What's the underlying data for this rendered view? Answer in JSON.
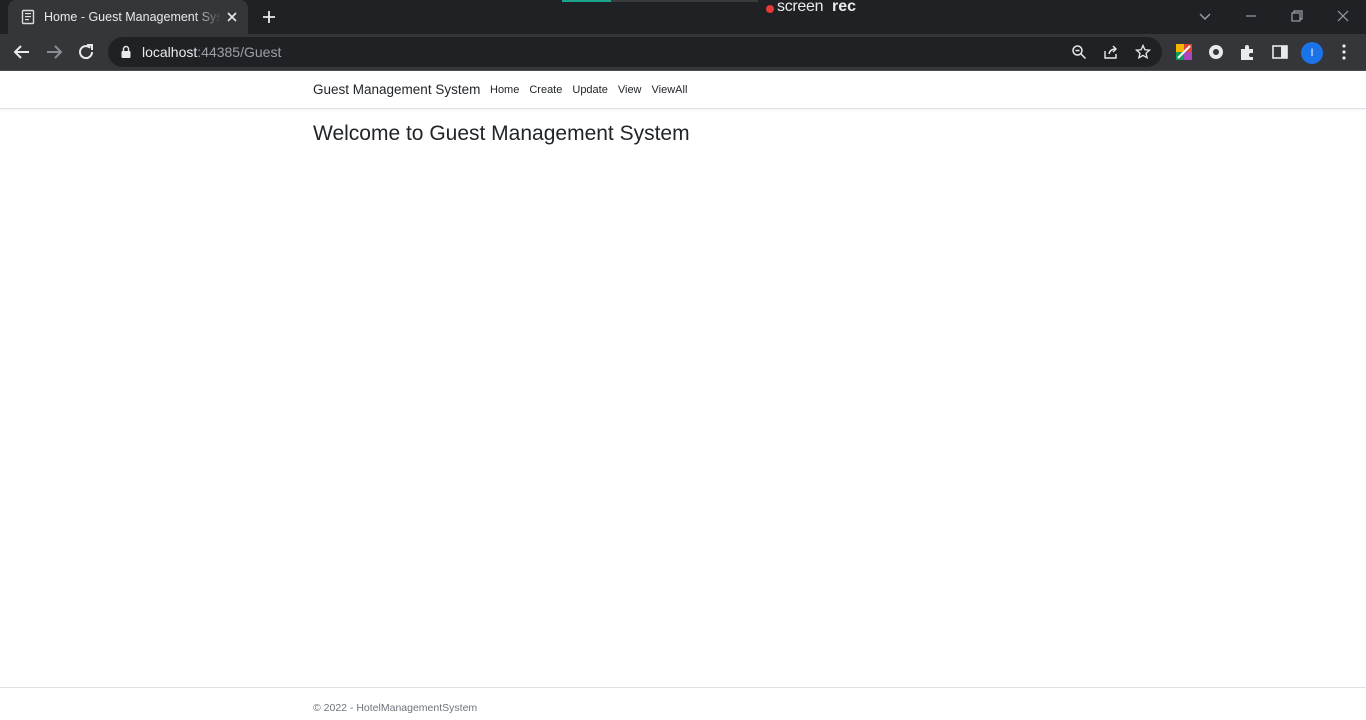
{
  "browser": {
    "tab_title": "Home - Guest Management System",
    "url_host": "localhost",
    "url_rest": ":44385/Guest",
    "profile_initial": "I",
    "recorder_brand_light": "screen",
    "recorder_brand_bold": "rec"
  },
  "navbar": {
    "brand": "Guest Management System",
    "links": [
      "Home",
      "Create",
      "Update",
      "View",
      "ViewAll"
    ]
  },
  "main": {
    "heading": "Welcome to Guest Management System"
  },
  "footer": {
    "text": "© 2022 - HotelManagementSystem"
  },
  "colors": {
    "chrome_dark": "#202124",
    "chrome_toolbar": "#35363a",
    "text_primary": "#212529",
    "text_muted": "#6c757d",
    "profile_blue": "#1a73e8"
  }
}
